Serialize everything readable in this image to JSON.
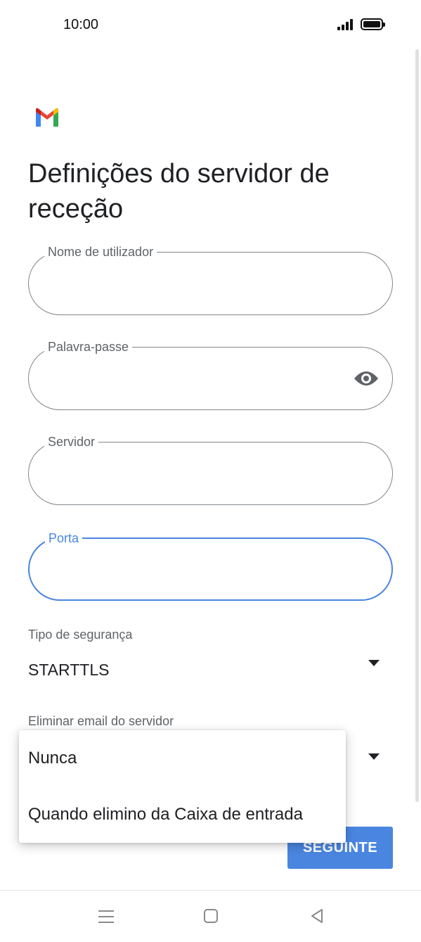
{
  "status_bar": {
    "time": "10:00"
  },
  "page": {
    "title": "Definições do servidor de receção"
  },
  "fields": {
    "username": {
      "label": "Nome de utilizador",
      "value": ""
    },
    "password": {
      "label": "Palavra-passe",
      "value": ""
    },
    "server": {
      "label": "Servidor",
      "value": ""
    },
    "port": {
      "label": "Porta",
      "value": ""
    }
  },
  "security": {
    "label": "Tipo de segurança",
    "value": "STARTTLS"
  },
  "delete_email": {
    "label": "Eliminar email do servidor",
    "options": [
      "Nunca",
      "Quando elimino da Caixa de entrada"
    ]
  },
  "actions": {
    "next_label": "SEGUINTE"
  },
  "icons": {
    "logo": "gmail-icon",
    "password_toggle": "eye-icon",
    "dropdown": "chevron-down-icon",
    "nav": [
      "menu-icon",
      "home-icon",
      "back-icon"
    ]
  },
  "colors": {
    "accent": "#4a86e0",
    "outline": "#80868b"
  }
}
